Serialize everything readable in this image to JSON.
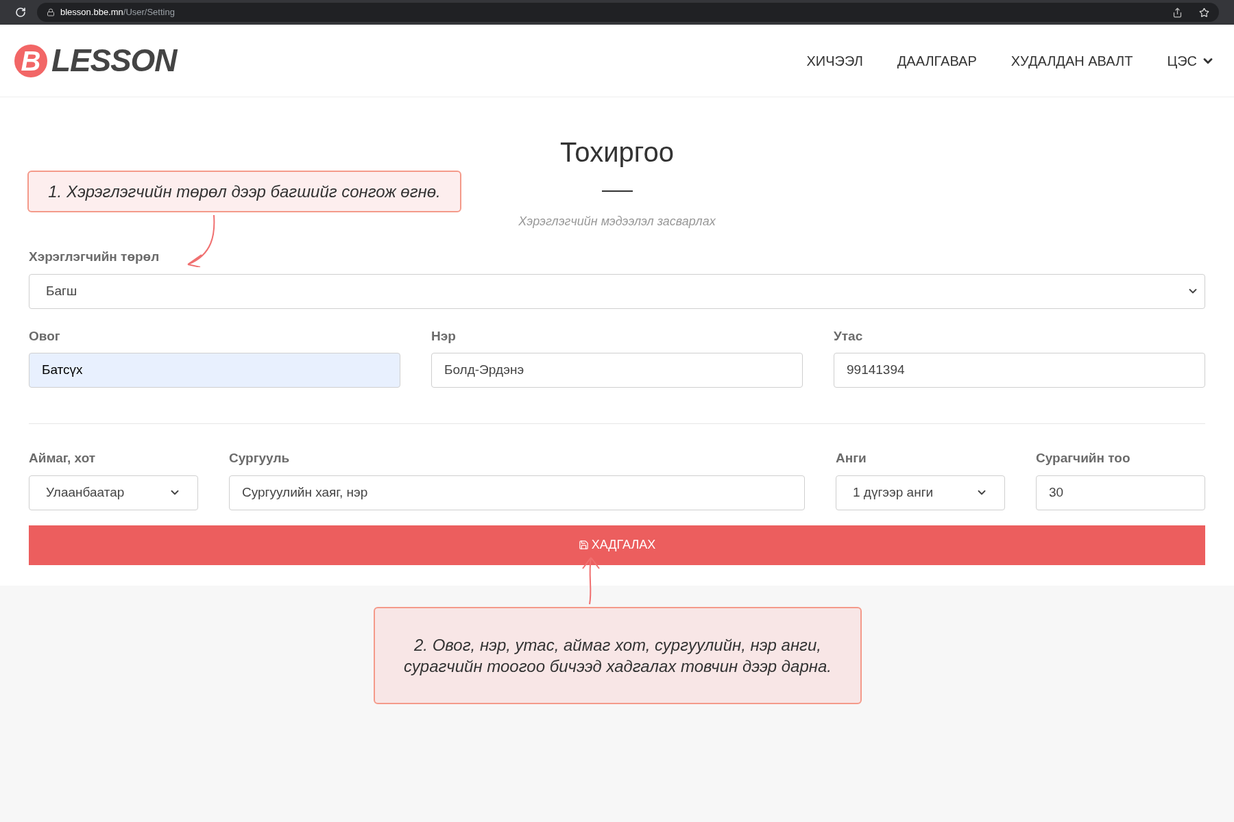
{
  "browser": {
    "url_host": "blesson.bbe.mn",
    "url_path": "/User/Setting"
  },
  "header": {
    "logo_letter": "B",
    "logo_text": "LESSON",
    "nav": [
      {
        "label": "ХИЧЭЭЛ",
        "kind": "link"
      },
      {
        "label": "ДААЛГАВАР",
        "kind": "link"
      },
      {
        "label": "ХУДАЛДАН АВАЛТ",
        "kind": "link"
      },
      {
        "label": "ЦЭС",
        "kind": "dropdown"
      }
    ]
  },
  "page": {
    "title": "Тохиргоо",
    "subtitle": "Хэрэглэгчийн мэдээлэл засварлах"
  },
  "user_type": {
    "label": "Хэрэглэгчийн төрөл",
    "value": "Багш"
  },
  "row_1": [
    {
      "label": "Овог",
      "value": "Батсүх",
      "autofilled": true
    },
    {
      "label": "Нэр",
      "value": "Болд-Эрдэнэ",
      "autofilled": false
    },
    {
      "label": "Утас",
      "value": "99141394",
      "autofilled": false
    }
  ],
  "row_2": [
    {
      "label": "Аймаг, хот",
      "value": "Улаанбаатар",
      "kind": "select"
    },
    {
      "label": "Сургууль",
      "value": "Сургуулийн хаяг, нэр",
      "kind": "input"
    },
    {
      "label": "Анги",
      "value": "1 дүгээр анги",
      "kind": "select"
    },
    {
      "label": "Сурагчийн тоо",
      "value": "30",
      "kind": "input"
    }
  ],
  "save_button": "ХАДГАЛАХ",
  "annotations": [
    "1. Хэрэглэгчийн төрөл дээр багшийг сонгож өгнө.",
    "2. Овог, нэр, утас, аймаг хот, сургуулийн, нэр анги, сурагчийн тоогоо бичээд хадгалах товчин дээр дарна."
  ]
}
